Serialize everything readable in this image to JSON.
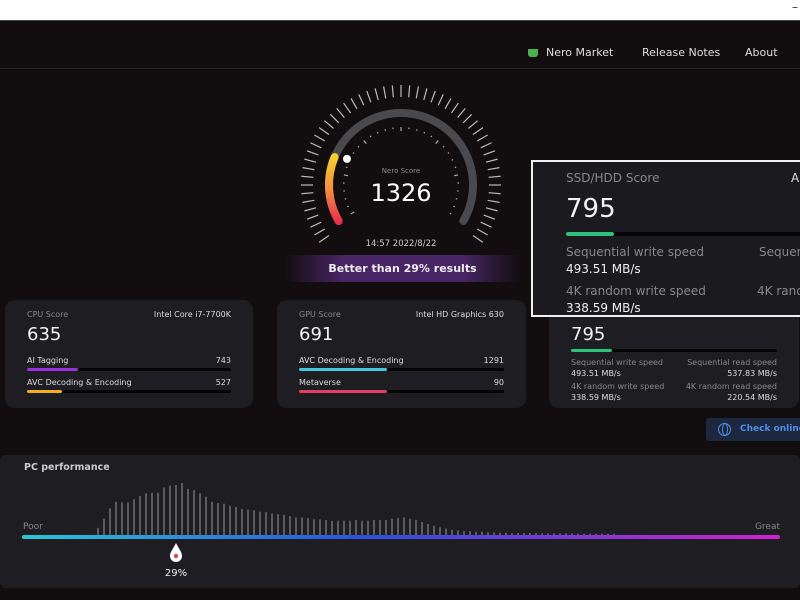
{
  "window": {
    "minimize_glyph": "–"
  },
  "nav": {
    "market": "Nero Market",
    "release": "Release Notes",
    "about": "About",
    "market_icon": "basket-icon"
  },
  "gauge": {
    "label": "Nero Score",
    "score": "1326",
    "timestamp": "14:57 2022/8/22",
    "percentile": 29
  },
  "banner": "Better than 29% results",
  "cpu": {
    "label": "CPU Score",
    "name": "Intel Core i7-7700K",
    "score": "635",
    "metrics": [
      {
        "label": "AI Tagging",
        "value": "743",
        "fill": 0.25,
        "color": "#9b30e0"
      },
      {
        "label": "AVC Decoding & Encoding",
        "value": "527",
        "fill": 0.17,
        "color": "#f0b020"
      }
    ]
  },
  "gpu": {
    "label": "GPU Score",
    "name": "Intel HD Graphics 630",
    "score": "691",
    "metrics": [
      {
        "label": "AVC Decoding & Encoding",
        "value": "1291",
        "fill": 0.43,
        "color": "#40c8e0"
      },
      {
        "label": "Metaverse",
        "value": "90",
        "fill": 0.43,
        "color": "#e04060"
      }
    ]
  },
  "ssd": {
    "label": "SSD/HDD Score",
    "name_partial": "AD",
    "score": "795",
    "fill": 0.2,
    "color": "#2ec27e",
    "seq_write_label": "Sequential write speed",
    "seq_write": "493.51 MB/s",
    "seq_read_label": "Sequential read speed",
    "seq_read": "537.83 MB/s",
    "rand_write_label": "4K random write speed",
    "rand_write": "338.59 MB/s",
    "rand_read_label": "4K random read speed",
    "rand_read": "220.54 MB/s",
    "seq_read_label_partial": "Sequen",
    "rand_read_label_partial": "4K rand"
  },
  "check_online": "Check online",
  "performance": {
    "title": "PC performance",
    "poor": "Poor",
    "great": "Great",
    "marker": "29%",
    "percentile": 29,
    "distribution": [
      22,
      50,
      82,
      102,
      100,
      100,
      110,
      120,
      128,
      130,
      130,
      146,
      152,
      154,
      160,
      142,
      138,
      128,
      118,
      102,
      98,
      96,
      90,
      86,
      80,
      78,
      76,
      72,
      70,
      66,
      64,
      62,
      58,
      54,
      54,
      52,
      48,
      48,
      46,
      44,
      44,
      44,
      44,
      46,
      44,
      44,
      46,
      46,
      46,
      50,
      52,
      54,
      50,
      46,
      40,
      34,
      28,
      24,
      20,
      16,
      14,
      12,
      12,
      10,
      10,
      8,
      8,
      7,
      7,
      6,
      6,
      6,
      6,
      6,
      5,
      5,
      5,
      5,
      5,
      5,
      4,
      4,
      4,
      4,
      4,
      4,
      4
    ]
  }
}
